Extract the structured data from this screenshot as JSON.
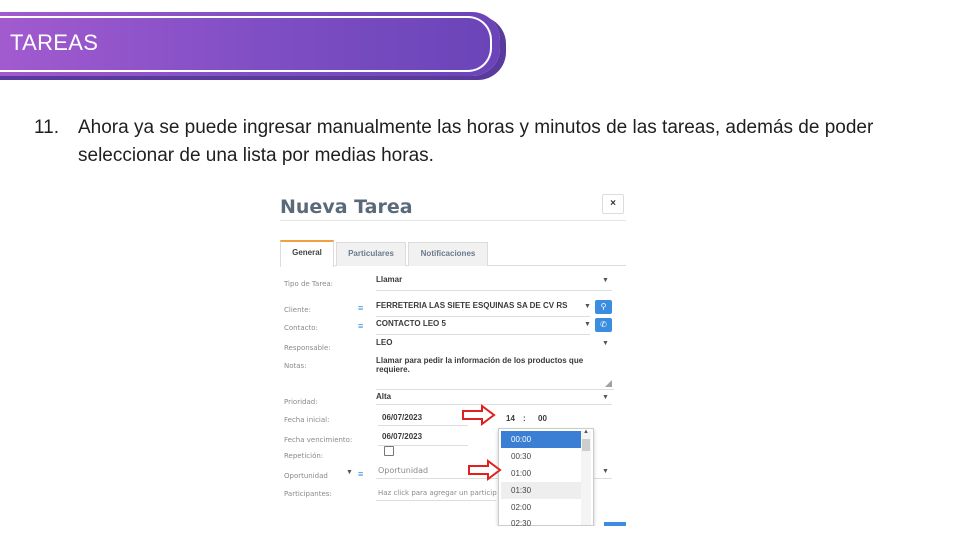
{
  "banner": {
    "title": "TAREAS"
  },
  "instruction": {
    "number": "11.",
    "text": "Ahora ya se puede ingresar manualmente las horas y minutos de las tareas, además de poder seleccionar de una lista por medias horas."
  },
  "dialog": {
    "title": "Nueva Tarea",
    "close": "×",
    "tabs": [
      "General",
      "Particulares",
      "Notificaciones"
    ],
    "fields": {
      "tipo_label": "Tipo de Tarea:",
      "tipo_value": "Llamar",
      "cliente_label": "Cliente:",
      "cliente_value": "FERRETERIA LAS SIETE ESQUINAS SA DE CV RS",
      "contacto_label": "Contacto:",
      "contacto_value": "CONTACTO LEO 5",
      "responsable_label": "Responsable:",
      "responsable_value": "LEO",
      "notas_label": "Notas:",
      "notas_value": "Llamar para pedir la información de los productos que requiere.",
      "prioridad_label": "Prioridad:",
      "prioridad_value": "Alta",
      "fecha_inicial_label": "Fecha inicial:",
      "fecha_inicial_value": "06/07/2023",
      "hora_value": "14",
      "hora_sep": ":",
      "minuto_value": "00",
      "fecha_venc_label": "Fecha vencimiento:",
      "fecha_venc_value": "06/07/2023",
      "repeticion_label": "Repetición:",
      "oportunidad_label": "Oportunidad",
      "oportunidad_placeholder": "Oportunidad",
      "participantes_label": "Participantes:",
      "participantes_placeholder": "Haz click para agregar un particip"
    },
    "time_options": [
      "00:00",
      "00:30",
      "01:00",
      "01:30",
      "02:00",
      "02:30"
    ],
    "selected_time": "00:00"
  },
  "colors": {
    "accent": "#3b8de0",
    "annotation_arrow": "#e02020",
    "banner": "#7f4ec4"
  }
}
